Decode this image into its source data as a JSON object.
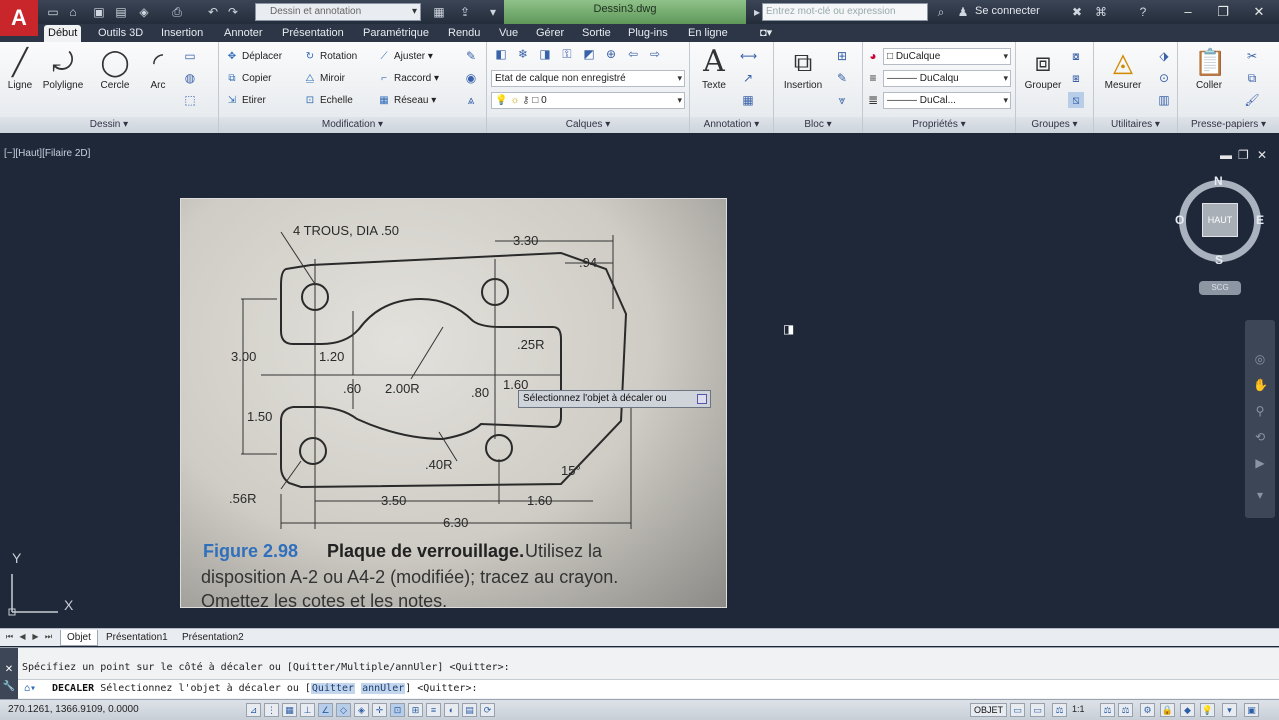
{
  "titlebar": {
    "workspace": "Dessin et annotation",
    "file_title": "Dessin3.dwg",
    "search_placeholder": "Entrez mot-clé ou expression",
    "login": "Se connecter"
  },
  "ribbon_tabs": [
    "Début",
    "Outils 3D",
    "Insertion",
    "Annoter",
    "Présentation",
    "Paramétrique",
    "Rendu",
    "Vue",
    "Gérer",
    "Sortie",
    "Plug-ins",
    "En ligne"
  ],
  "panels": {
    "dessin": {
      "title": "Dessin",
      "ligne": "Ligne",
      "polyligne": "Polyligne",
      "cercle": "Cercle",
      "arc": "Arc"
    },
    "modification": {
      "title": "Modification",
      "deplacer": "Déplacer",
      "rotation": "Rotation",
      "ajuster": "Ajuster",
      "copier": "Copier",
      "miroir": "Miroir",
      "raccord": "Raccord",
      "etirer": "Etirer",
      "echelle": "Echelle",
      "reseau": "Réseau"
    },
    "calques": {
      "title": "Calques",
      "layer_state": "Etat de calque non enregistré",
      "current_layer": "0"
    },
    "annotation": {
      "title": "Annotation",
      "texte": "Texte"
    },
    "bloc": {
      "title": "Bloc",
      "insertion": "Insertion"
    },
    "proprietes": {
      "title": "Propriétés",
      "color": "DuCalque",
      "linetype": "DuCalqu",
      "lineweight": "DuCal..."
    },
    "groupes": {
      "title": "Groupes",
      "grouper": "Grouper"
    },
    "utilitaires": {
      "title": "Utilitaires",
      "mesurer": "Mesurer"
    },
    "presse_papiers": {
      "title": "Presse-papiers",
      "coller": "Coller"
    }
  },
  "viewport": {
    "label": "[−][Haut][Filaire 2D]",
    "cursor_prompt": "Sélectionnez l'objet à décaler ou",
    "viewcube": {
      "north": "N",
      "south": "S",
      "east": "E",
      "west": "O",
      "face": "HAUT",
      "wcs": "SCG"
    },
    "ucs": {
      "x": "X",
      "y": "Y"
    }
  },
  "drawing_photo": {
    "callout_holes": "4 TROUS, DIA .50",
    "dims": {
      "d330": "3.30",
      "d94": ".94",
      "d25r": ".25R",
      "d300": "3.00",
      "d120": "1.20",
      "d60": ".60",
      "d200r": "2.00R",
      "d80": ".80",
      "d160v": "1.60",
      "d150": "1.50",
      "d40r": ".40R",
      "d15deg": "15°",
      "d56r": ".56R",
      "d350": "3.50",
      "d160h": "1.60",
      "d630": "6.30"
    },
    "figure_number": "Figure 2.98",
    "figure_title": "Plaque de verrouillage.",
    "figure_text_1": "Utilisez la",
    "figure_text_2": "disposition A-2 ou A4-2 (modifiée); tracez au crayon.",
    "figure_text_3": "Omettez les cotes et les notes."
  },
  "layout_tabs": [
    "Objet",
    "Présentation1",
    "Présentation2"
  ],
  "command": {
    "history": "Spécifiez un point sur le côté à décaler ou [Quitter/Multiple/annUler] <Quitter>:",
    "name": "DECALER",
    "prompt": "Sélectionnez l'objet à décaler ou [",
    "kw1": "Quitter",
    "kw2": "annUler",
    "tail": "] <Quitter>:"
  },
  "status": {
    "coords": "270.1261, 1366.9109, 0.0000",
    "model": "OBJET",
    "scale": "1:1"
  },
  "colors": {
    "accent": "#2e6bb5",
    "viewport_bg": "#1e2839",
    "title_green": "#6fa56a"
  }
}
